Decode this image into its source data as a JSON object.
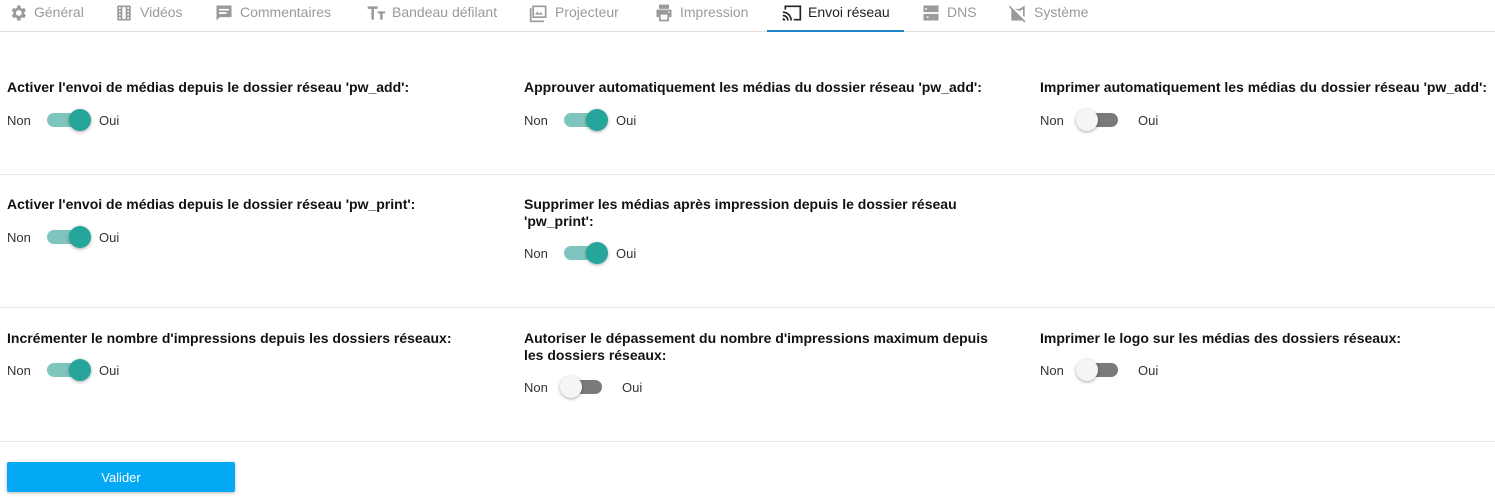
{
  "tabs": [
    {
      "label": "Général",
      "icon": "gear-icon"
    },
    {
      "label": "Vidéos",
      "icon": "film-icon"
    },
    {
      "label": "Commentaires",
      "icon": "comment-icon"
    },
    {
      "label": "Bandeau défilant",
      "icon": "text-size-icon"
    },
    {
      "label": "Projecteur",
      "icon": "image-icon"
    },
    {
      "label": "Impression",
      "icon": "printer-icon"
    },
    {
      "label": "Envoi réseau",
      "icon": "cast-icon",
      "active": true
    },
    {
      "label": "DNS",
      "icon": "dns-icon"
    },
    {
      "label": "Système",
      "icon": "system-icon"
    }
  ],
  "switch_labels": {
    "off": "Non",
    "on": "Oui"
  },
  "settings": {
    "enable_pw_add": {
      "title": "Activer l'envoi de médias depuis le dossier réseau 'pw_add':",
      "value": true
    },
    "approve_pw_add": {
      "title": "Approuver automatiquement les médias du dossier réseau 'pw_add':",
      "value": true
    },
    "print_pw_add": {
      "title": "Imprimer automatiquement les médias du dossier réseau 'pw_add':",
      "value": false
    },
    "enable_pw_print": {
      "title": "Activer l'envoi de médias depuis le dossier réseau 'pw_print':",
      "value": true
    },
    "delete_after_print": {
      "title": "Supprimer les médias après impression depuis le dossier réseau 'pw_print':",
      "value": true
    },
    "increment_prints": {
      "title": "Incrémenter le nombre d'impressions depuis les dossiers réseaux:",
      "value": true
    },
    "allow_exceed": {
      "title": "Autoriser le dépassement du nombre d'impressions maximum depuis les dossiers réseaux:",
      "value": false
    },
    "print_logo": {
      "title": "Imprimer le logo sur les médias des dossiers réseaux:",
      "value": false
    }
  },
  "submit_label": "Valider",
  "colors": {
    "accent": "#03a9f4",
    "switch_on": "#26a69a",
    "switch_track_on": "#7fc5bd",
    "switch_track_off": "#7a7a7a",
    "tab_underline": "#1e88c9"
  }
}
